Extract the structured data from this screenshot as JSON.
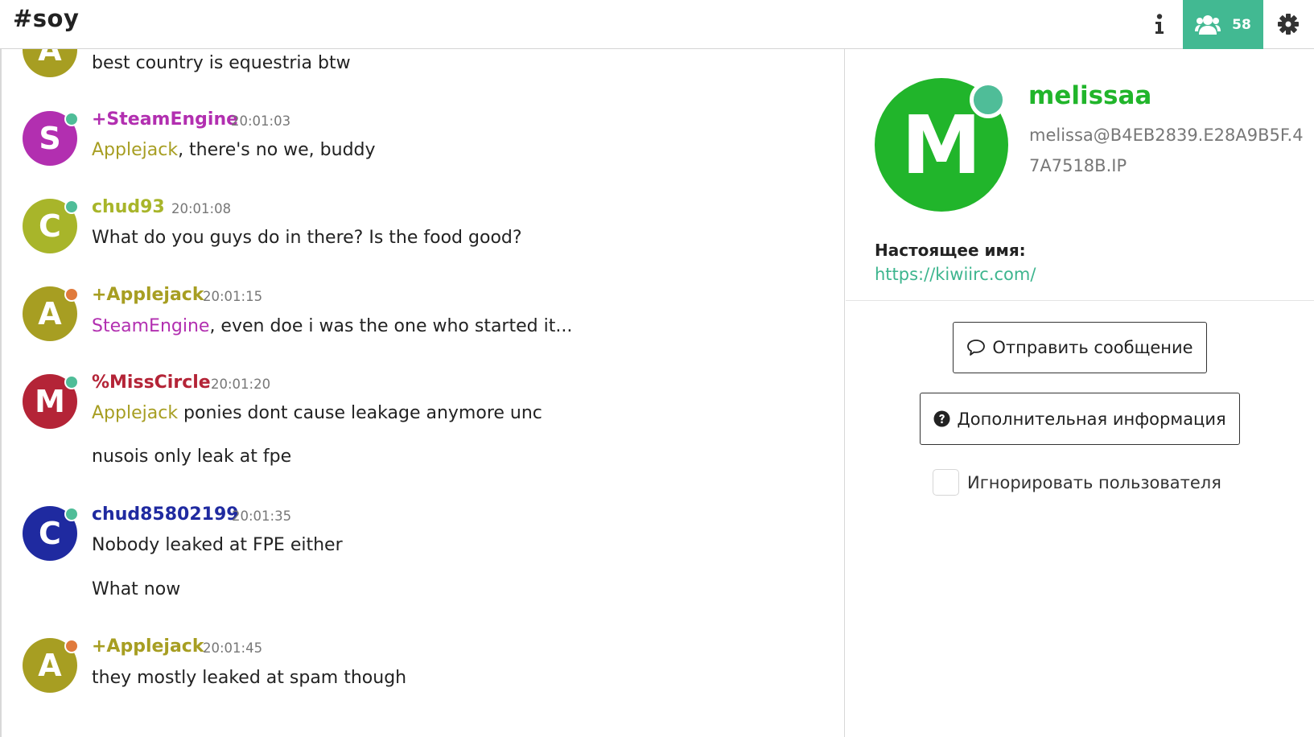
{
  "header": {
    "channel": "#soy",
    "user_count": "58",
    "icons": {
      "info": "info-icon",
      "users": "users-icon",
      "settings": "gear-icon"
    }
  },
  "colors": {
    "accent": "#42b992",
    "steamengine": "#b22fb0",
    "applejack": "#a79e22",
    "chud93": "#a8b52a",
    "misscircle": "#b42437",
    "chud85802199": "#1f2aa0",
    "online": "#4fbd98",
    "away": "#e07a3c",
    "melissaa": "#21b52b"
  },
  "messages": [
    {
      "text": "best country is equestria btw",
      "avatar_letter": "A"
    },
    {
      "nick": "+SteamEngine",
      "time": "20:01:03",
      "avatar_letter": "S",
      "mention": "Applejack",
      "text": ", there's no we, buddy"
    },
    {
      "nick": "chud93",
      "time": "20:01:08",
      "avatar_letter": "C",
      "text": "What do you guys do in there? Is the food good?"
    },
    {
      "nick": "+Applejack",
      "time": "20:01:15",
      "avatar_letter": "A",
      "mention": "SteamEngine",
      "text": ", even doe i was the one who started it..."
    },
    {
      "nick": "%MissCircle",
      "time": "20:01:20",
      "avatar_letter": "M",
      "mention": "Applejack",
      "text": " ponies dont cause leakage anymore unc",
      "text2": "nusois only leak at fpe"
    },
    {
      "nick": "chud85802199",
      "time": "20:01:35",
      "avatar_letter": "C",
      "text": "Nobody leaked at FPE either",
      "text2": "What now"
    },
    {
      "nick": "+Applejack",
      "time": "20:01:45",
      "avatar_letter": "A",
      "text": "they mostly leaked at spam though"
    }
  ],
  "profile": {
    "avatar_letter": "M",
    "nick": "melissaa",
    "host": "melissa@B4EB2839.E28A9B5F.47A7518B.IP",
    "realname_label": "Настоящее имя:",
    "realname_url": "https://kiwiirc.com/",
    "send_message_label": "Отправить сообщение",
    "more_info_label": "Дополнительная информация",
    "ignore_label": "Игнорировать пользователя",
    "ignore_checked": false
  }
}
